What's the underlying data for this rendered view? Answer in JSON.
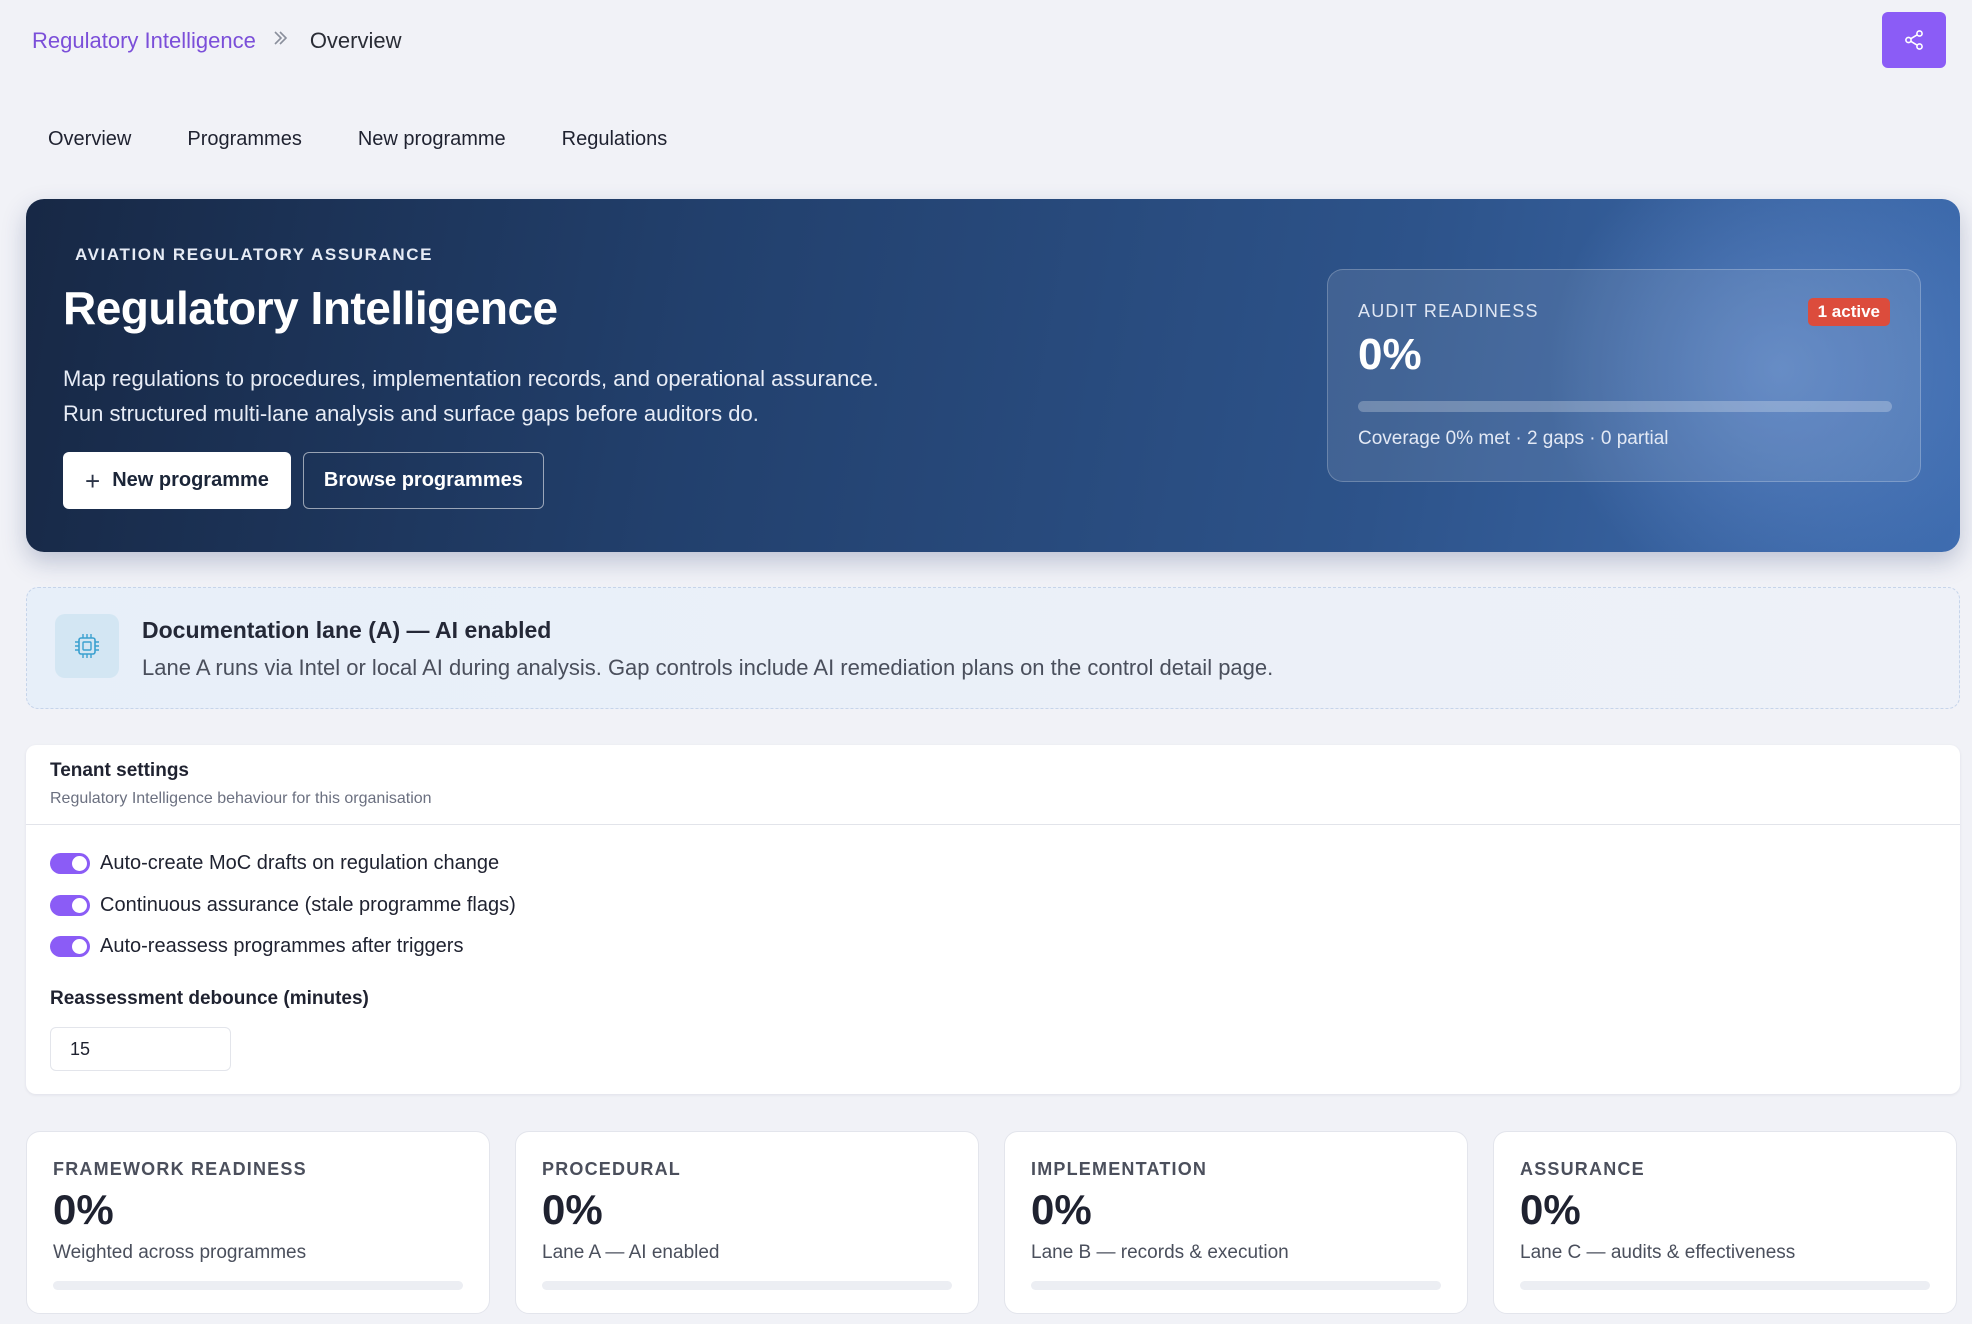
{
  "breadcrumb": {
    "root": "Regulatory Intelligence",
    "current": "Overview"
  },
  "tabs": [
    {
      "label": "Overview"
    },
    {
      "label": "Programmes"
    },
    {
      "label": "New programme"
    },
    {
      "label": "Regulations"
    }
  ],
  "hero": {
    "eyebrow": "AVIATION REGULATORY ASSURANCE",
    "title": "Regulatory Intelligence",
    "desc_line1": "Map regulations to procedures, implementation records, and operational assurance.",
    "desc_line2": "Run structured multi-lane analysis and surface gaps before auditors do.",
    "new_programme_label": "New programme",
    "browse_label": "Browse programmes"
  },
  "readiness": {
    "label": "AUDIT READINESS",
    "badge": "1 active",
    "value": "0%",
    "progress_percent": 0,
    "coverage": "Coverage 0% met · 2 gaps · 0 partial"
  },
  "lane_banner": {
    "icon": "chip-icon",
    "title": "Documentation lane (A) — AI enabled",
    "desc": "Lane A runs via Intel or local AI during analysis. Gap controls include AI remediation plans on the control detail page."
  },
  "tenant": {
    "title": "Tenant settings",
    "subtitle": "Regulatory Intelligence behaviour for this organisation",
    "toggles": [
      {
        "label": "Auto-create MoC drafts on regulation change",
        "on": true
      },
      {
        "label": "Continuous assurance (stale programme flags)",
        "on": true
      },
      {
        "label": "Auto-reassess programmes after triggers",
        "on": true
      }
    ],
    "debounce_label": "Reassessment debounce (minutes)",
    "debounce_value": "15"
  },
  "metrics": [
    {
      "label": "FRAMEWORK READINESS",
      "value": "0%",
      "desc": "Weighted across programmes",
      "progress_percent": 0
    },
    {
      "label": "PROCEDURAL",
      "value": "0%",
      "desc": "Lane A — AI enabled",
      "progress_percent": 0
    },
    {
      "label": "IMPLEMENTATION",
      "value": "0%",
      "desc": "Lane B — records & execution",
      "progress_percent": 0
    },
    {
      "label": "ASSURANCE",
      "value": "0%",
      "desc": "Lane C — audits & effectiveness",
      "progress_percent": 0
    }
  ],
  "colors": {
    "accent": "#8b5cf6",
    "badge": "#dc4c3c",
    "hero_dark": "#172845"
  }
}
